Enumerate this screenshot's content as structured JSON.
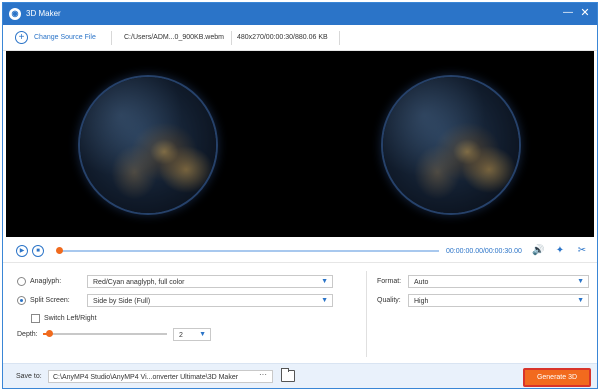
{
  "window": {
    "title": "3D Maker",
    "app_icon": "3d-maker-logo",
    "minimize_icon": "minimize-icon",
    "close_icon": "close-icon"
  },
  "source": {
    "change_label": "Change Source File",
    "file_path": "C:/Users/ADM...0_900KB.webm",
    "file_info": "480x270/00:00:30/880.06 KB"
  },
  "playback": {
    "time": "00:00:00.00/00:00:30.00",
    "progress": 0
  },
  "settings": {
    "anaglyph_label": "Anaglyph:",
    "anaglyph_value": "Red/Cyan anaglyph, full color",
    "split_label": "Split Screen:",
    "split_value": "Side by Side (Full)",
    "switch_label": "Switch Left/Right",
    "depth_label": "Depth:",
    "depth_value": "2",
    "depth_level": 0.05,
    "format_label": "Format:",
    "format_value": "Auto",
    "quality_label": "Quality:",
    "quality_value": "High",
    "selected_mode": "split"
  },
  "footer": {
    "save_label": "Save to:",
    "save_path": "C:\\AnyMP4 Studio\\AnyMP4 Vi...onverter Ultimate\\3D Maker",
    "dots": "···",
    "generate_label": "Generate 3D"
  },
  "colors": {
    "accent": "#2b74c8",
    "orange": "#f26a1e",
    "highlight_border": "#d8342a"
  }
}
